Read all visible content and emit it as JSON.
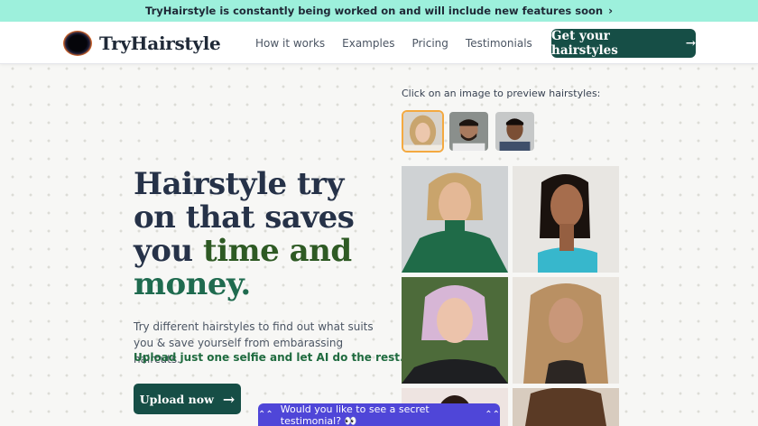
{
  "announcement": {
    "text": "TryHairstyle is constantly being worked on and will include new features soon",
    "chevron": "›"
  },
  "nav": {
    "logo_text": "TryHairstyle",
    "links": [
      "How it works",
      "Examples",
      "Pricing",
      "Testimonials"
    ],
    "cta_label": "Get your hairstyles",
    "cta_arrow": "→"
  },
  "hero": {
    "line1": "Hairstyle try",
    "line2": "on that saves",
    "line3_prefix": "you ",
    "line3_highlight": "time and",
    "line4_highlight": "money.",
    "subtitle": "Try different hairstyles to find out what suits you & save yourself from embarassing haircuts.",
    "subtitle_strong": "Upload just one selfie and let AI do the rest.",
    "upload_label": "Upload now",
    "upload_arrow": "→"
  },
  "preview": {
    "label": "Click on an image to preview hairstyles:"
  },
  "testimonial_chip": {
    "text": "Would you like to see a secret testimonial? 👀",
    "arrow": "⌃⌃"
  },
  "colors": {
    "announce_bg": "#9df0dc",
    "primary": "#164e46",
    "highlight_dark": "#2e5a24",
    "highlight_green": "#1f6b4f",
    "chip": "#4f46d8",
    "selected_border": "#f4a940"
  }
}
